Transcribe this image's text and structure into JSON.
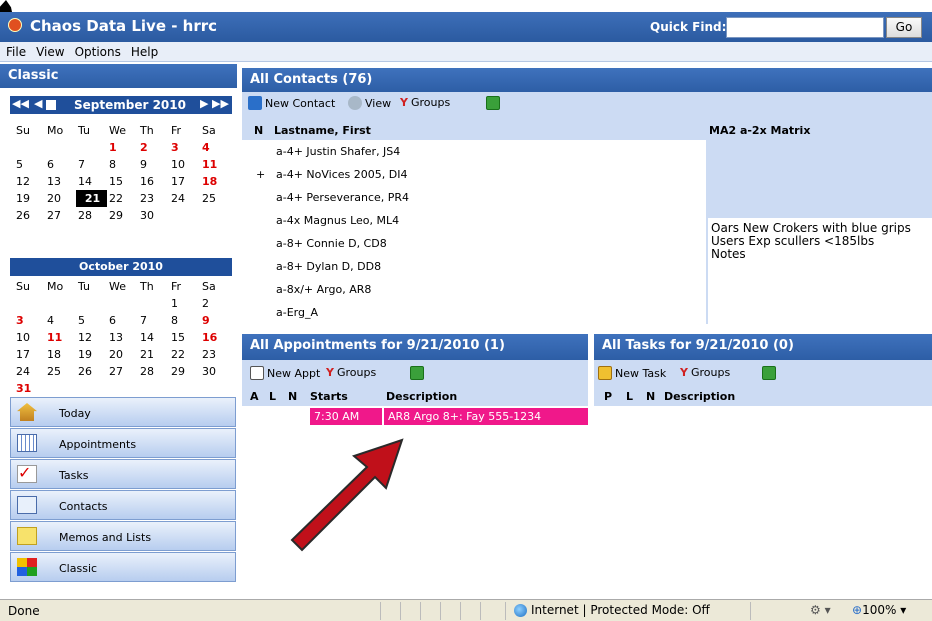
{
  "title": "Chaos Data Live - hrrc",
  "quick_find_label": "Quick Find:",
  "go_label": "Go",
  "menu": [
    "File",
    "View",
    "Options",
    "Help"
  ],
  "left_panel_title": "Classic",
  "cal1": {
    "title": "September 2010",
    "days": [
      "Su",
      "Mo",
      "Tu",
      "We",
      "Th",
      "Fr",
      "Sa"
    ],
    "rows": [
      [
        "",
        "",
        "",
        "1",
        "2",
        "3",
        "4"
      ],
      [
        "5",
        "6",
        "7",
        "8",
        "9",
        "10",
        "11"
      ],
      [
        "12",
        "13",
        "14",
        "15",
        "16",
        "17",
        "18"
      ],
      [
        "19",
        "20",
        "21",
        "22",
        "23",
        "24",
        "25"
      ],
      [
        "26",
        "27",
        "28",
        "29",
        "30",
        "",
        ""
      ]
    ]
  },
  "cal2": {
    "title": "October 2010",
    "days": [
      "Su",
      "Mo",
      "Tu",
      "We",
      "Th",
      "Fr",
      "Sa"
    ],
    "rows": [
      [
        "",
        "",
        "",
        "",
        "",
        "1",
        "2"
      ],
      [
        "3",
        "4",
        "5",
        "6",
        "7",
        "8",
        "9"
      ],
      [
        "10",
        "11",
        "12",
        "13",
        "14",
        "15",
        "16"
      ],
      [
        "17",
        "18",
        "19",
        "20",
        "21",
        "22",
        "23"
      ],
      [
        "24",
        "25",
        "26",
        "27",
        "28",
        "29",
        "30"
      ],
      [
        "31",
        "",
        "",
        "",
        "",
        "",
        ""
      ]
    ]
  },
  "nav": [
    "Today",
    "Appointments",
    "Tasks",
    "Contacts",
    "Memos and Lists",
    "Classic"
  ],
  "contacts": {
    "title": "All Contacts (76)",
    "new_label": "New Contact",
    "view_label": "View",
    "groups_label": "Groups",
    "col_n": "N",
    "col_name": "Lastname, First",
    "matrix_title": "MA2 a-2x Matrix",
    "rows": [
      {
        "n": "",
        "name": "a-4+ Justin Shafer, JS4"
      },
      {
        "n": "+",
        "name": "a-4+ NoVices 2005, DI4"
      },
      {
        "n": "",
        "name": "a-4+ Perseverance, PR4"
      },
      {
        "n": "",
        "name": "a-4x Magnus Leo, ML4"
      },
      {
        "n": "",
        "name": "a-8+ Connie D, CD8"
      },
      {
        "n": "",
        "name": "a-8+ Dylan D, DD8"
      },
      {
        "n": "",
        "name": "a-8x/+ Argo, AR8"
      },
      {
        "n": "",
        "name": "a-Erg_A"
      }
    ],
    "notes": [
      "Oars New Crokers with blue grips",
      "Users Exp scullers <185lbs",
      "Notes"
    ]
  },
  "appts": {
    "title": "All Appointments for 9/21/2010 (1)",
    "new_label": "New Appt",
    "groups_label": "Groups",
    "cols": [
      "A",
      "L",
      "N",
      "Starts",
      "Description"
    ],
    "rows": [
      {
        "starts": "7:30 AM",
        "desc": "AR8 Argo 8+: Fay 555-1234"
      }
    ]
  },
  "tasks": {
    "title": "All Tasks for 9/21/2010 (0)",
    "new_label": "New Task",
    "groups_label": "Groups",
    "cols": [
      "P",
      "L",
      "N",
      "Description"
    ]
  },
  "status": {
    "left": "Done",
    "zone": "Internet | Protected Mode: Off",
    "zoom": "100%"
  },
  "colors": {
    "header": "#2d5ea6",
    "pink": "#f0188a",
    "toolbar": "#ccdbf3",
    "arrow": "#c0101a"
  }
}
